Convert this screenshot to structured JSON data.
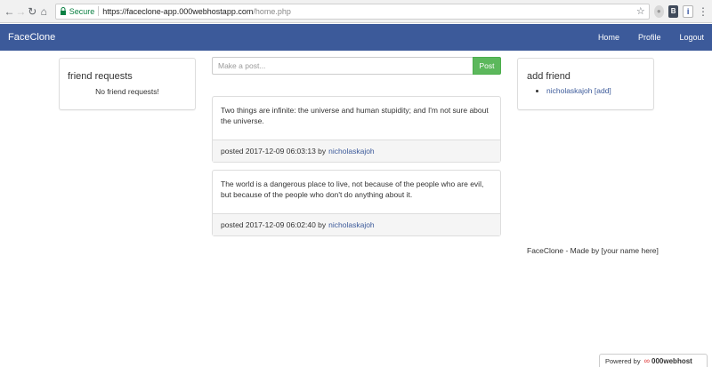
{
  "browser": {
    "secure_label": "Secure",
    "url_host": "https://faceclone-app.000webhostapp.com",
    "url_path": "/home.php",
    "ext_b": "B",
    "ext_mark": "i"
  },
  "navbar": {
    "brand": "FaceClone",
    "links": [
      "Home",
      "Profile",
      "Logout"
    ]
  },
  "friend_requests": {
    "title": "friend requests",
    "empty": "No friend requests!"
  },
  "composer": {
    "placeholder": "Make a post...",
    "button": "Post"
  },
  "posts": [
    {
      "text": "Two things are infinite: the universe and human stupidity; and I'm not sure about the universe.",
      "meta": "posted 2017-12-09 06:03:13 by",
      "author": "nicholaskajoh"
    },
    {
      "text": "The world is a dangerous place to live, not because of the people who are evil, but because of the people who don't do anything about it.",
      "meta": "posted 2017-12-09 06:02:40 by",
      "author": "nicholaskajoh"
    }
  ],
  "add_friend": {
    "title": "add friend",
    "user": "nicholaskajoh",
    "action": "[add]"
  },
  "footer": "FaceClone - Made by [your name here]",
  "powered": {
    "prefix": "Powered by",
    "brand": "000webhost"
  },
  "colors": {
    "navbar": "#3c5a9a",
    "post_button": "#5cb85c",
    "link": "#3c5a9a"
  }
}
